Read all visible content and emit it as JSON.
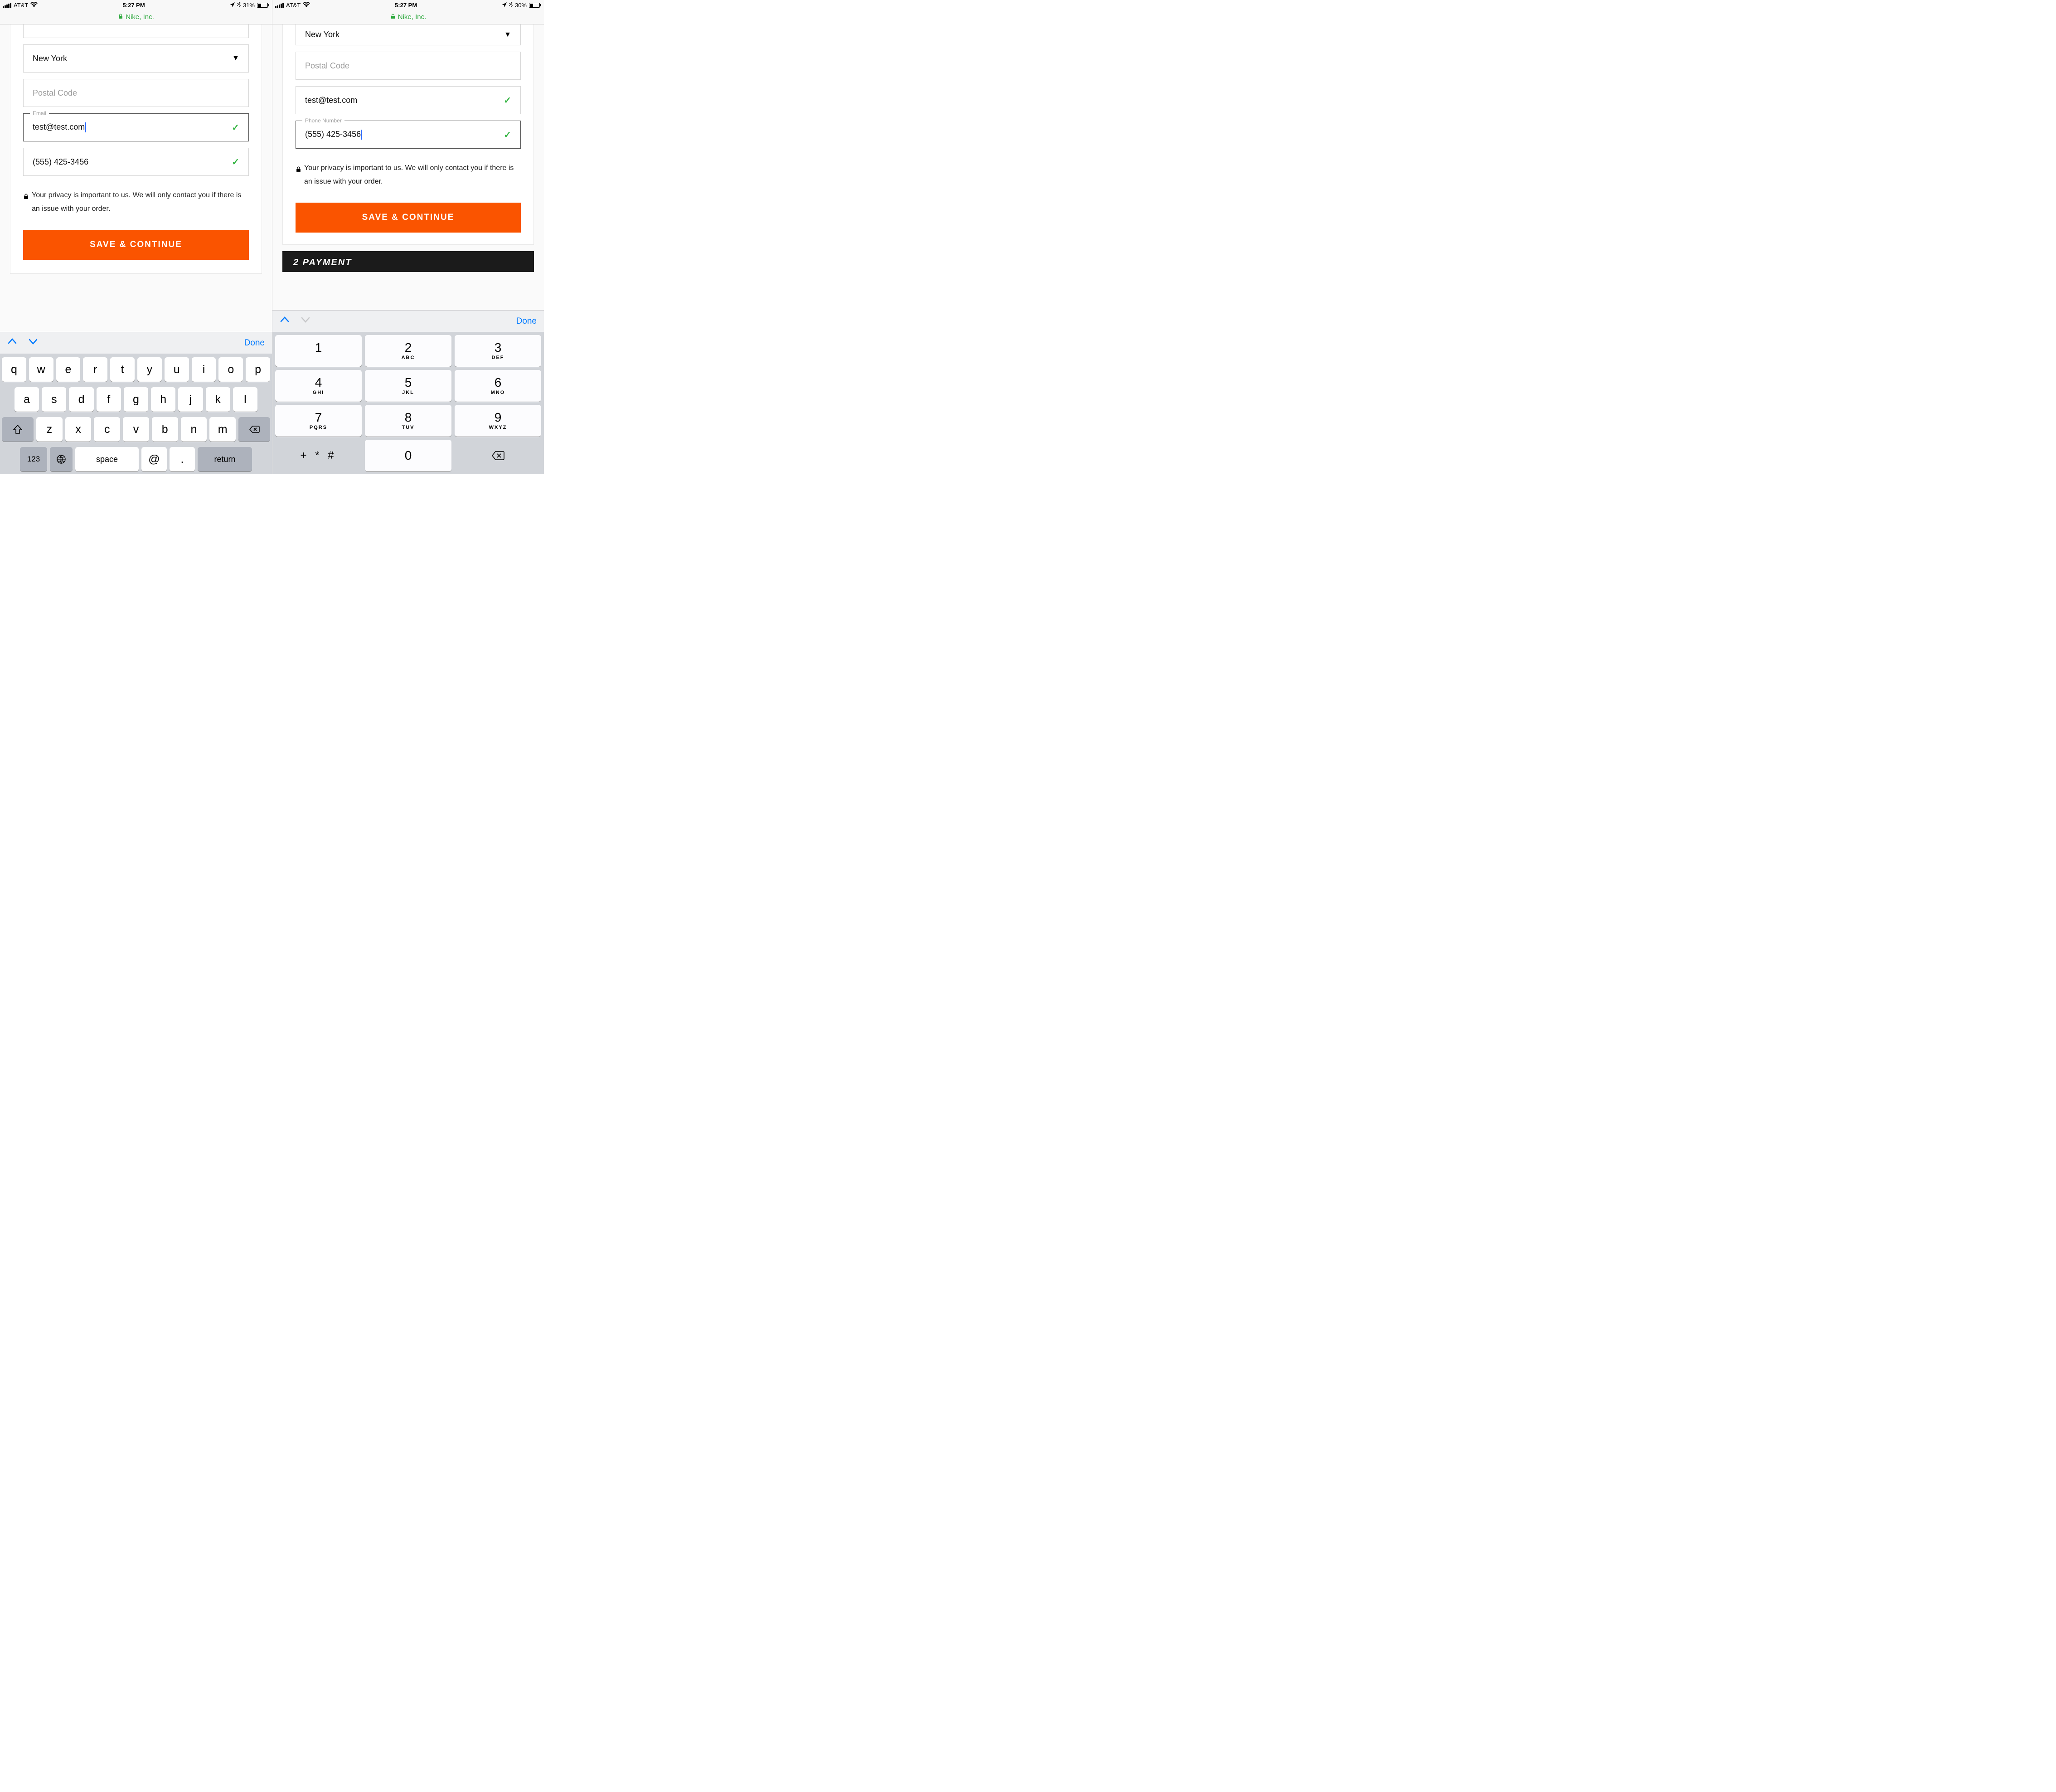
{
  "left": {
    "status": {
      "carrier": "AT&T",
      "time": "5:27 PM",
      "battery_pct": "31%",
      "battery_fill_pct": 31
    },
    "url_bar": {
      "site": "Nike, Inc."
    },
    "form": {
      "state_value": "New York",
      "postal_placeholder": "Postal Code",
      "email_label": "Email",
      "email_value": "test@test.com",
      "phone_value": "(555) 425-3456",
      "privacy_text": "Your privacy is important to us. We will only contact you if there is an issue with your order.",
      "save_label": "SAVE & CONTINUE"
    },
    "kb_accessory": {
      "done": "Done"
    },
    "qwerty": {
      "row1": [
        "q",
        "w",
        "e",
        "r",
        "t",
        "y",
        "u",
        "i",
        "o",
        "p"
      ],
      "row2": [
        "a",
        "s",
        "d",
        "f",
        "g",
        "h",
        "j",
        "k",
        "l"
      ],
      "row3": [
        "z",
        "x",
        "c",
        "v",
        "b",
        "n",
        "m"
      ],
      "k123": "123",
      "space": "space",
      "at": "@",
      "dot": ".",
      "ret": "return"
    }
  },
  "right": {
    "status": {
      "carrier": "AT&T",
      "time": "5:27 PM",
      "battery_pct": "30%",
      "battery_fill_pct": 30
    },
    "url_bar": {
      "site": "Nike, Inc."
    },
    "form": {
      "state_value": "New York",
      "postal_placeholder": "Postal Code",
      "email_value": "test@test.com",
      "phone_label": "Phone Number",
      "phone_value": "(555) 425-3456",
      "privacy_text": "Your privacy is important to us. We will only contact you if there is an issue with your order.",
      "save_label": "SAVE & CONTINUE"
    },
    "payment_step": "2  PAYMENT",
    "kb_accessory": {
      "done": "Done"
    },
    "numpad": {
      "keys": [
        {
          "d": "1",
          "l": ""
        },
        {
          "d": "2",
          "l": "ABC"
        },
        {
          "d": "3",
          "l": "DEF"
        },
        {
          "d": "4",
          "l": "GHI"
        },
        {
          "d": "5",
          "l": "JKL"
        },
        {
          "d": "6",
          "l": "MNO"
        },
        {
          "d": "7",
          "l": "PQRS"
        },
        {
          "d": "8",
          "l": "TUV"
        },
        {
          "d": "9",
          "l": "WXYZ"
        }
      ],
      "sym": "+ * #",
      "zero": "0"
    }
  }
}
